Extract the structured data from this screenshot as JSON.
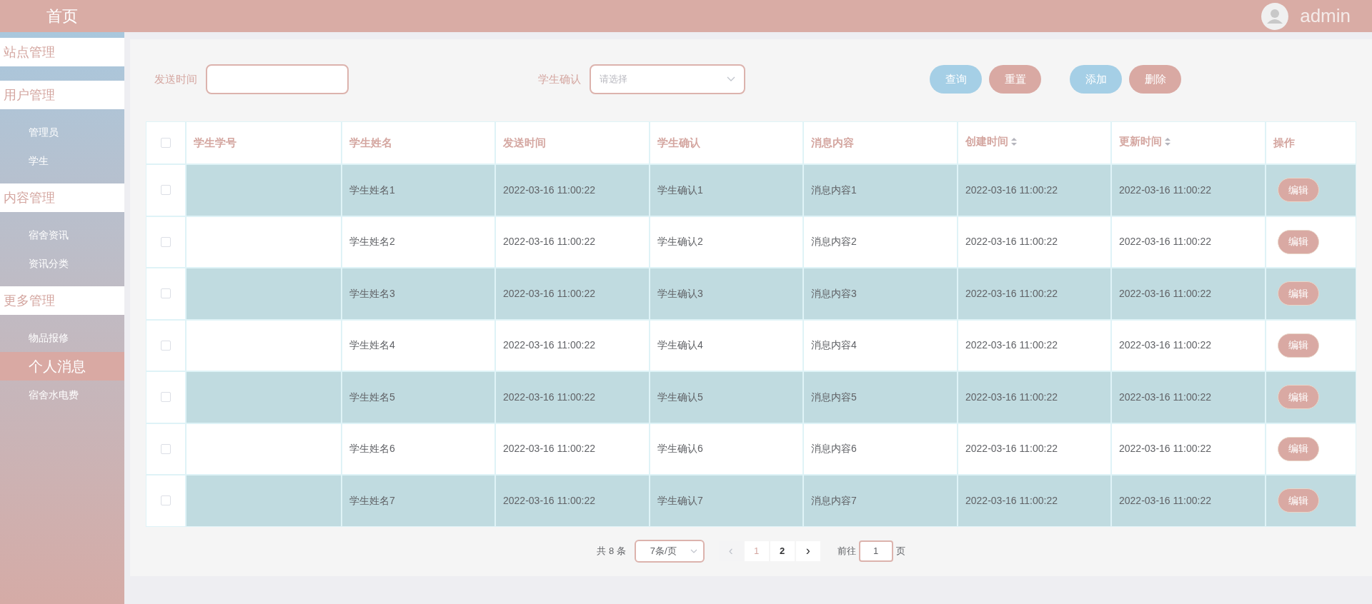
{
  "sidebar": {
    "title": "首页",
    "groups": [
      {
        "label": "站点管理"
      },
      {
        "label": "用户管理",
        "children": [
          {
            "label": "管理员",
            "selected": false
          },
          {
            "label": "学生",
            "selected": false
          }
        ]
      },
      {
        "label": "内容管理",
        "children": [
          {
            "label": "宿舍资讯",
            "selected": false
          },
          {
            "label": "资讯分类",
            "selected": false
          }
        ]
      },
      {
        "label": "更多管理",
        "children": [
          {
            "label": "物品报修",
            "selected": false
          },
          {
            "label": "个人消息",
            "selected": true
          },
          {
            "label": "宿舍水电费",
            "selected": false
          }
        ]
      }
    ]
  },
  "header": {
    "user": "admin"
  },
  "search": {
    "fields": [
      {
        "kind": "input",
        "label": "发送时间"
      },
      {
        "kind": "select",
        "label": "学生确认",
        "placeholder": "请选择"
      }
    ],
    "buttons": [
      {
        "label": "查询",
        "color": "#a5cfe6"
      },
      {
        "label": "重置",
        "color": "#d9a9a3"
      },
      {
        "label": "添加",
        "color": "#a5cfe6"
      },
      {
        "label": "删除",
        "color": "#d9a9a3"
      }
    ]
  },
  "table": {
    "all_checked": false,
    "columns": [
      {
        "label": "学生学号",
        "sortable": false
      },
      {
        "label": "学生姓名",
        "sortable": false
      },
      {
        "label": "发送时间",
        "sortable": false
      },
      {
        "label": "学生确认",
        "sortable": false
      },
      {
        "label": "消息内容",
        "sortable": false
      },
      {
        "label": "创建时间",
        "sortable": true
      },
      {
        "label": "更新时间",
        "sortable": true
      },
      {
        "label": "操作",
        "sortable": false
      }
    ],
    "rows": [
      {
        "checked": false,
        "cells": [
          "",
          "学生姓名1",
          "2022-03-16 11:00:22",
          "学生确认1",
          "消息内容1",
          "2022-03-16 11:00:22",
          "2022-03-16 11:00:22"
        ],
        "action": "编辑"
      },
      {
        "checked": false,
        "cells": [
          "",
          "学生姓名2",
          "2022-03-16 11:00:22",
          "学生确认2",
          "消息内容2",
          "2022-03-16 11:00:22",
          "2022-03-16 11:00:22"
        ],
        "action": "编辑"
      },
      {
        "checked": false,
        "cells": [
          "",
          "学生姓名3",
          "2022-03-16 11:00:22",
          "学生确认3",
          "消息内容3",
          "2022-03-16 11:00:22",
          "2022-03-16 11:00:22"
        ],
        "action": "编辑"
      },
      {
        "checked": false,
        "cells": [
          "",
          "学生姓名4",
          "2022-03-16 11:00:22",
          "学生确认4",
          "消息内容4",
          "2022-03-16 11:00:22",
          "2022-03-16 11:00:22"
        ],
        "action": "编辑"
      },
      {
        "checked": false,
        "cells": [
          "",
          "学生姓名5",
          "2022-03-16 11:00:22",
          "学生确认5",
          "消息内容5",
          "2022-03-16 11:00:22",
          "2022-03-16 11:00:22"
        ],
        "action": "编辑"
      },
      {
        "checked": false,
        "cells": [
          "",
          "学生姓名6",
          "2022-03-16 11:00:22",
          "学生确认6",
          "消息内容6",
          "2022-03-16 11:00:22",
          "2022-03-16 11:00:22"
        ],
        "action": "编辑"
      },
      {
        "checked": false,
        "cells": [
          "",
          "学生姓名7",
          "2022-03-16 11:00:22",
          "学生确认7",
          "消息内容7",
          "2022-03-16 11:00:22",
          "2022-03-16 11:00:22"
        ],
        "action": "编辑"
      }
    ]
  },
  "pagination": {
    "total": "共 8 条",
    "page_size": "7条/页",
    "prev": "‹",
    "pages": [
      {
        "label": "1",
        "selected": true
      },
      {
        "label": "2",
        "selected": false
      }
    ],
    "next": "›",
    "goto_label": "前往",
    "goto_value": "1",
    "goto_suffix": "页"
  }
}
